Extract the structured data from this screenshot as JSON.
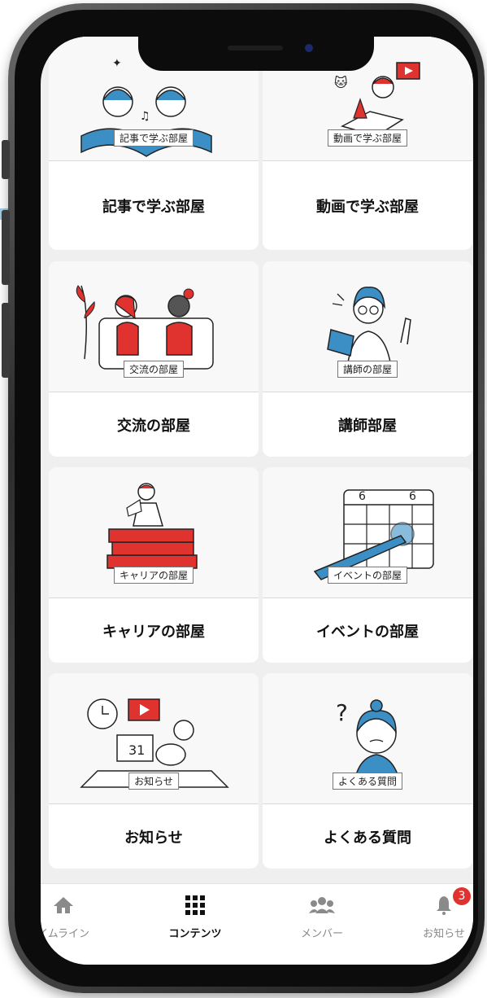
{
  "cards": [
    {
      "label": "記事で学ぶ部屋",
      "title": "記事で学ぶ部屋"
    },
    {
      "label": "動画で学ぶ部屋",
      "title": "動画で学ぶ部屋"
    },
    {
      "label": "交流の部屋",
      "title": "交流の部屋"
    },
    {
      "label": "講師の部屋",
      "title": "講師部屋"
    },
    {
      "label": "キャリアの部屋",
      "title": "キャリアの部屋"
    },
    {
      "label": "イベントの部屋",
      "title": "イベントの部屋"
    },
    {
      "label": "お知らせ",
      "title": "お知らせ"
    },
    {
      "label": "よくある質問",
      "title": "よくある質問"
    }
  ],
  "tabbar": {
    "tabs": [
      {
        "label": "イムライン",
        "icon": "home-icon"
      },
      {
        "label": "コンテンツ",
        "icon": "grid-icon",
        "active": true
      },
      {
        "label": "メンバー",
        "icon": "users-icon"
      },
      {
        "label": "お知らせ",
        "icon": "bell-icon"
      }
    ],
    "notification_count": "3"
  },
  "colors": {
    "accent_red": "#e0322f",
    "illustration_blue": "#3c8fc4",
    "screen_bg": "#efefef"
  }
}
